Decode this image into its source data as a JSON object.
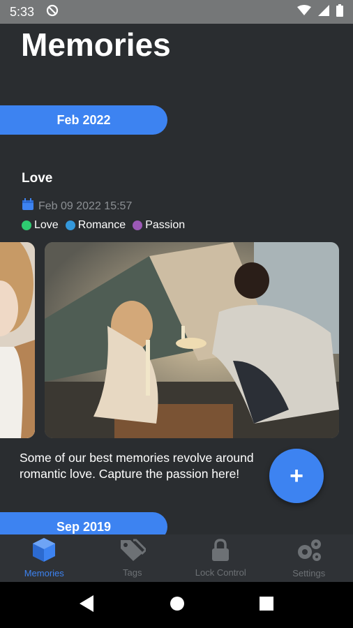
{
  "status_bar": {
    "time": "5:33"
  },
  "header": {
    "title": "Memories"
  },
  "sections": [
    {
      "month": "Feb 2022"
    },
    {
      "month": "Sep 2019"
    }
  ],
  "entry": {
    "title": "Love",
    "date": "Feb 09 2022 15:57",
    "tags": [
      {
        "label": "Love",
        "color": "#2ecc71"
      },
      {
        "label": "Romance",
        "color": "#3498db"
      },
      {
        "label": "Passion",
        "color": "#9b59b6"
      }
    ],
    "caption": "Some of our best memories revolve around romantic love. Capture the passion here!"
  },
  "fab": {
    "label": "+"
  },
  "bottom_nav": [
    {
      "label": "Memories",
      "icon": "cube-icon",
      "active": true
    },
    {
      "label": "Tags",
      "icon": "tags-icon",
      "active": false
    },
    {
      "label": "Lock Control",
      "icon": "lock-icon",
      "active": false
    },
    {
      "label": "Settings",
      "icon": "gears-icon",
      "active": false
    }
  ],
  "colors": {
    "accent": "#3d83f1",
    "background": "#2a2d30",
    "nav_background": "#2f3236"
  }
}
